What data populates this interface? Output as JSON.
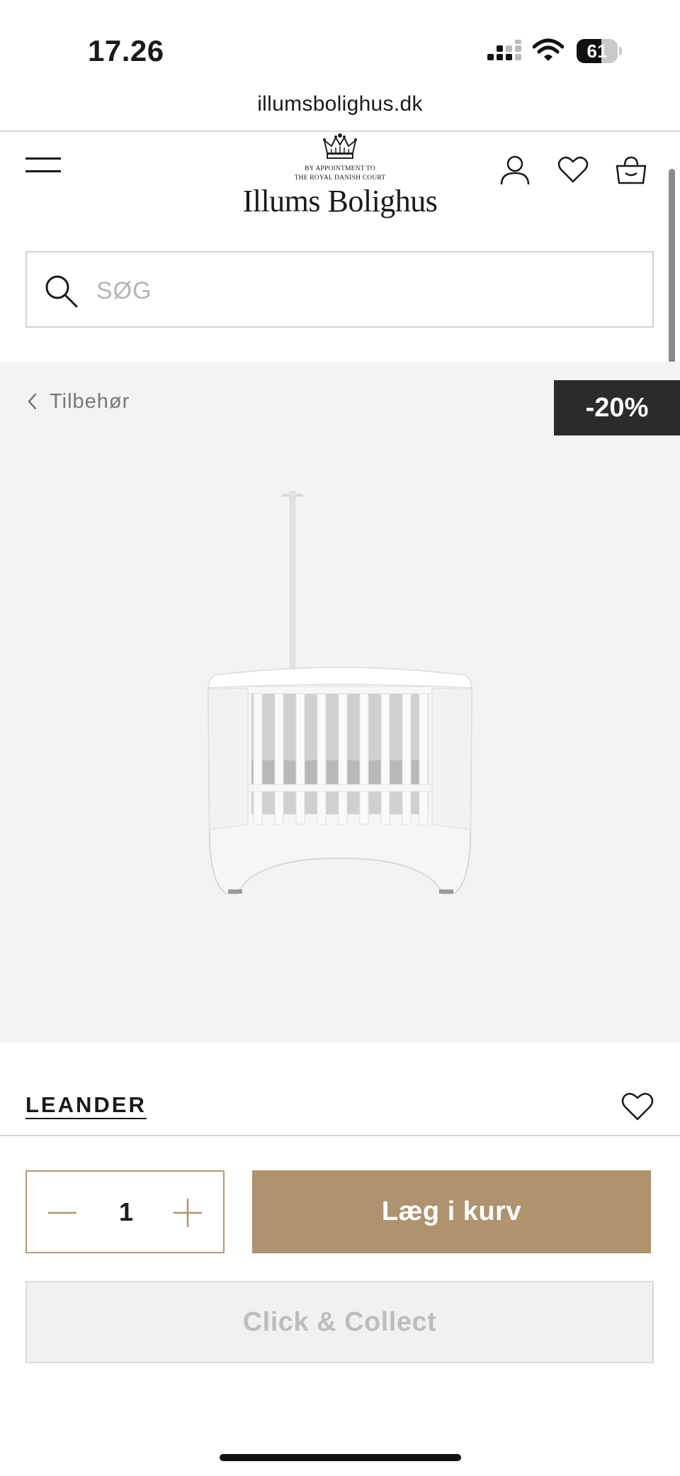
{
  "status_bar": {
    "time": "17.26",
    "battery_level": "61",
    "battery_fraction": 0.61
  },
  "browser": {
    "url": "illumsbolighus.dk"
  },
  "header": {
    "logo_appointment_line1": "BY APPOINTMENT TO",
    "logo_appointment_line2": "THE ROYAL DANISH COURT",
    "logo_name": "Illums Bolighus",
    "icons": [
      "menu-icon",
      "user-icon",
      "heart-icon",
      "basket-icon"
    ]
  },
  "search": {
    "placeholder": "SØG",
    "value": ""
  },
  "product": {
    "breadcrumb": "Tilbehør",
    "discount": "-20%",
    "brand": "LEANDER",
    "quantity": "1",
    "add_to_cart_label": "Læg i kurv",
    "click_collect_label": "Click & Collect"
  },
  "colors": {
    "accent": "#ae936e",
    "badge_bg": "#2b2b2b",
    "image_bg": "#f3f3f3",
    "disabled_bg": "#f1f1f1"
  }
}
